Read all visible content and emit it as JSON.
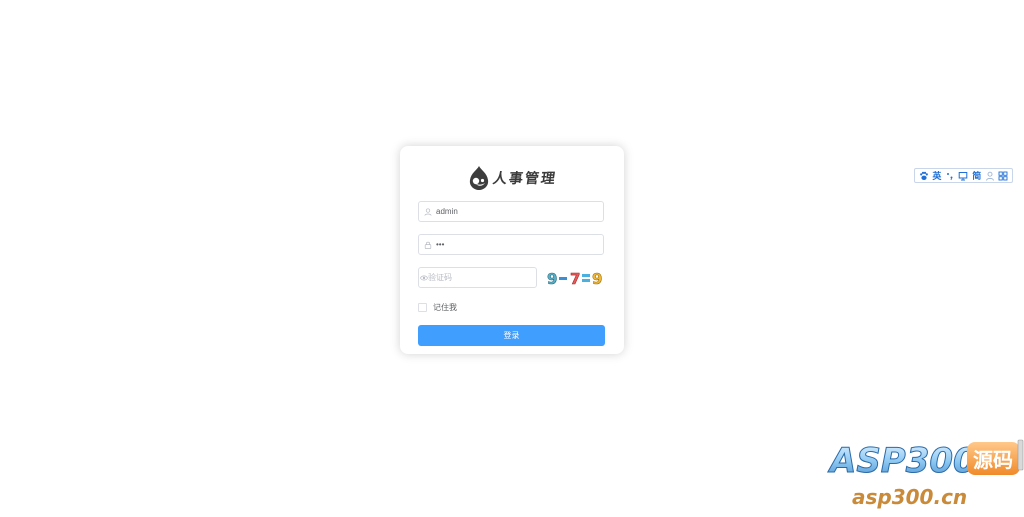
{
  "login": {
    "logo_text": "人事管理",
    "username": {
      "value": "admin",
      "placeholder": ""
    },
    "password": {
      "value": "•••",
      "placeholder": ""
    },
    "captcha": {
      "value": "",
      "placeholder": "验证码",
      "image_text": "9-7=9"
    },
    "remember_label": "记住我",
    "remember_checked": false,
    "submit_label": "登录",
    "accent_color": "#409eff"
  },
  "ime_toolbar": {
    "items": [
      {
        "icon": "paw-icon"
      },
      {
        "label": "英"
      },
      {
        "icon": "punctuation-icon"
      },
      {
        "icon": "cup-icon"
      },
      {
        "label": "简"
      },
      {
        "icon": "user-icon"
      },
      {
        "icon": "grid-icon"
      }
    ]
  },
  "watermark": {
    "brand": "ASP300",
    "badge": "源码",
    "url": "asp300.cn"
  }
}
